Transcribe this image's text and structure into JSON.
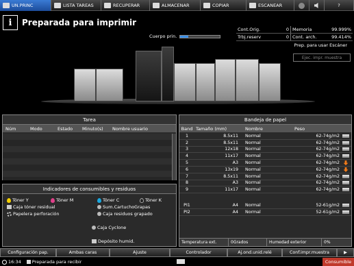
{
  "tabs": [
    {
      "label": "UN.PRINC",
      "active": true
    },
    {
      "label": "LISTA TAREAS",
      "active": false
    },
    {
      "label": "RECUPERAR",
      "active": false
    },
    {
      "label": "ALMACENAR",
      "active": false
    },
    {
      "label": "COPIAR",
      "active": false
    },
    {
      "label": "ESCANEAR",
      "active": false
    },
    {
      "label": "?",
      "active": false
    }
  ],
  "status": {
    "message": "Preparada para imprimir",
    "cuerpo_label": "Cuerpo prin.",
    "cuerpo_progress": 0.2,
    "scanner_status": "Prep. para usar Escáner",
    "ejec_button": "Ejec. impr. muestra"
  },
  "counters": {
    "cont_orig_label": "Cont.Orig.",
    "cont_orig_value": "0",
    "memoria_label": "Memoria",
    "memoria_value": "99.999%",
    "trbj_reserv_label": "Trbj.reserv",
    "trbj_reserv_value": "0",
    "cont_arch_label": "Cont. arch.",
    "cont_arch_value": "99.414%"
  },
  "tarea": {
    "title": "Tarea",
    "columns": [
      "Núm",
      "Modo",
      "Estado",
      "Minuto(s)",
      "Nombre usuario"
    ]
  },
  "consumibles": {
    "title": "Indicadores de consumibles y residuos",
    "items": {
      "toner_y": "Tóner Y",
      "toner_m": "Tóner M",
      "toner_c": "Tóner C",
      "toner_k": "Tóner K",
      "caja_toner": "Caja tóner residual",
      "sum_cartucho": "Sum.CartuchoGrapas",
      "papelera": "Papelera perforación",
      "caja_residuos": "Caja residuos grapado",
      "caja_cyclone": "Caja Cyclone",
      "deposito": "Depósito humid."
    }
  },
  "bandeja": {
    "title": "Bandeja de papel",
    "columns": [
      "Band",
      "Tamaño (mm)",
      "Nombre",
      "Peso"
    ],
    "rows": [
      {
        "band": "1",
        "size": "8.5x11",
        "name": "Normal",
        "weight": "62-74g/m2",
        "arrow": false
      },
      {
        "band": "2",
        "size": "8.5x11",
        "name": "Normal",
        "weight": "62-74g/m2",
        "arrow": false
      },
      {
        "band": "3",
        "size": "12x18",
        "name": "Normal",
        "weight": "62-74g/m2",
        "arrow": false
      },
      {
        "band": "4",
        "size": "11x17",
        "name": "Normal",
        "weight": "62-74g/m2",
        "arrow": false
      },
      {
        "band": "5",
        "size": "A3",
        "name": "Normal",
        "weight": "62-74g/m2",
        "arrow": true
      },
      {
        "band": "6",
        "size": "13x19",
        "name": "Normal",
        "weight": "62-74g/m2",
        "arrow": true
      },
      {
        "band": "7",
        "size": "8.5x11",
        "name": "Normal",
        "weight": "62-74g/m2",
        "arrow": false
      },
      {
        "band": "8",
        "size": "A3",
        "name": "Normal",
        "weight": "62-74g/m2",
        "arrow": false
      },
      {
        "band": "9",
        "size": "11x17",
        "name": "Normal",
        "weight": "62-74g/m2",
        "arrow": false
      }
    ],
    "extra_rows": [
      {
        "band": "PI1",
        "size": "A4",
        "name": "Normal",
        "weight": "52-61g/m2"
      },
      {
        "band": "PI2",
        "size": "A4",
        "name": "Normal",
        "weight": "52-61g/m2"
      }
    ],
    "temp_label": "Temperatura ext.",
    "temp_value": "0Grados",
    "hum_label": "Humedad exterior",
    "hum_value": "0%"
  },
  "buttons": {
    "config": "Configuración pap.",
    "ambas": "Ambas caras",
    "ajuste": "Ajuste",
    "controlador": "Controlador",
    "aj_ond": "Aj.ond.unid.relé",
    "conf_impr": "Conf.impr.muestra",
    "next": "▶"
  },
  "statusbar": {
    "time": "16:34",
    "message": "Preparada para recibir",
    "consumible": "Consumible"
  }
}
